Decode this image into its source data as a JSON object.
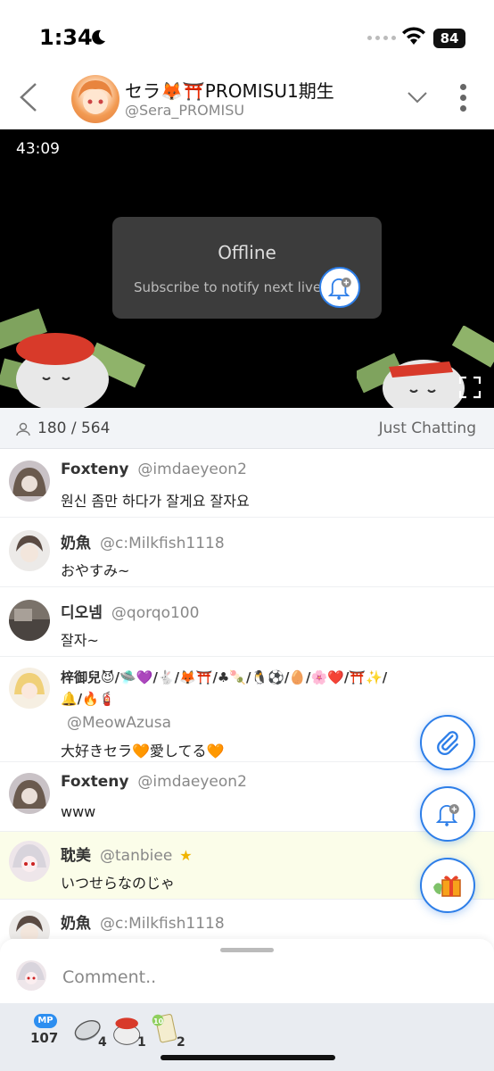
{
  "status_bar": {
    "time": "1:34",
    "battery": "84"
  },
  "header": {
    "channel_name": "セラ🦊⛩️PROMISU1期生",
    "channel_handle": "@Sera_PROMISU"
  },
  "video": {
    "timer": "43:09",
    "offline_title": "Offline",
    "offline_subtitle": "Subscribe to notify next live"
  },
  "info_bar": {
    "viewers": "180 / 564",
    "category": "Just Chatting"
  },
  "chat": [
    {
      "name": "Foxteny",
      "handle": "@imdaeyeon2",
      "text": "원신 좀만 하다가 잘게요 잘자요"
    },
    {
      "name": "奶魚",
      "handle": "@c:Milkfish1118",
      "text": "おやすみ~"
    },
    {
      "name": "디오넴",
      "handle": "@qorqo100",
      "text": "잘자~"
    },
    {
      "name_line1": "梓御兒😈/🛸💜/🐇/🦊⛩️/♣🍡/🐧⚽/🥚/🌸❤️/⛩️✨/",
      "name_line2": "🔔/🔥🧯",
      "handle": "@MeowAzusa",
      "text": "大好きセラ🧡愛してる🧡"
    },
    {
      "name": "Foxteny",
      "handle": "@imdaeyeon2",
      "text": "www"
    },
    {
      "name": "耽美",
      "handle": "@tanbiee",
      "text": "いつせらなのじゃ"
    },
    {
      "name": "奶魚",
      "handle": "@c:Milkfish1118",
      "text": ""
    }
  ],
  "comment": {
    "placeholder": "Comment.."
  },
  "tray": {
    "mp_label": "MP",
    "mp_value": "107",
    "coin_count": "4",
    "mascot_count": "1",
    "card_count": "2",
    "card_badge": "10"
  },
  "colors": {
    "accent": "#2d7ee8",
    "highlight_row": "#fbfde9"
  }
}
